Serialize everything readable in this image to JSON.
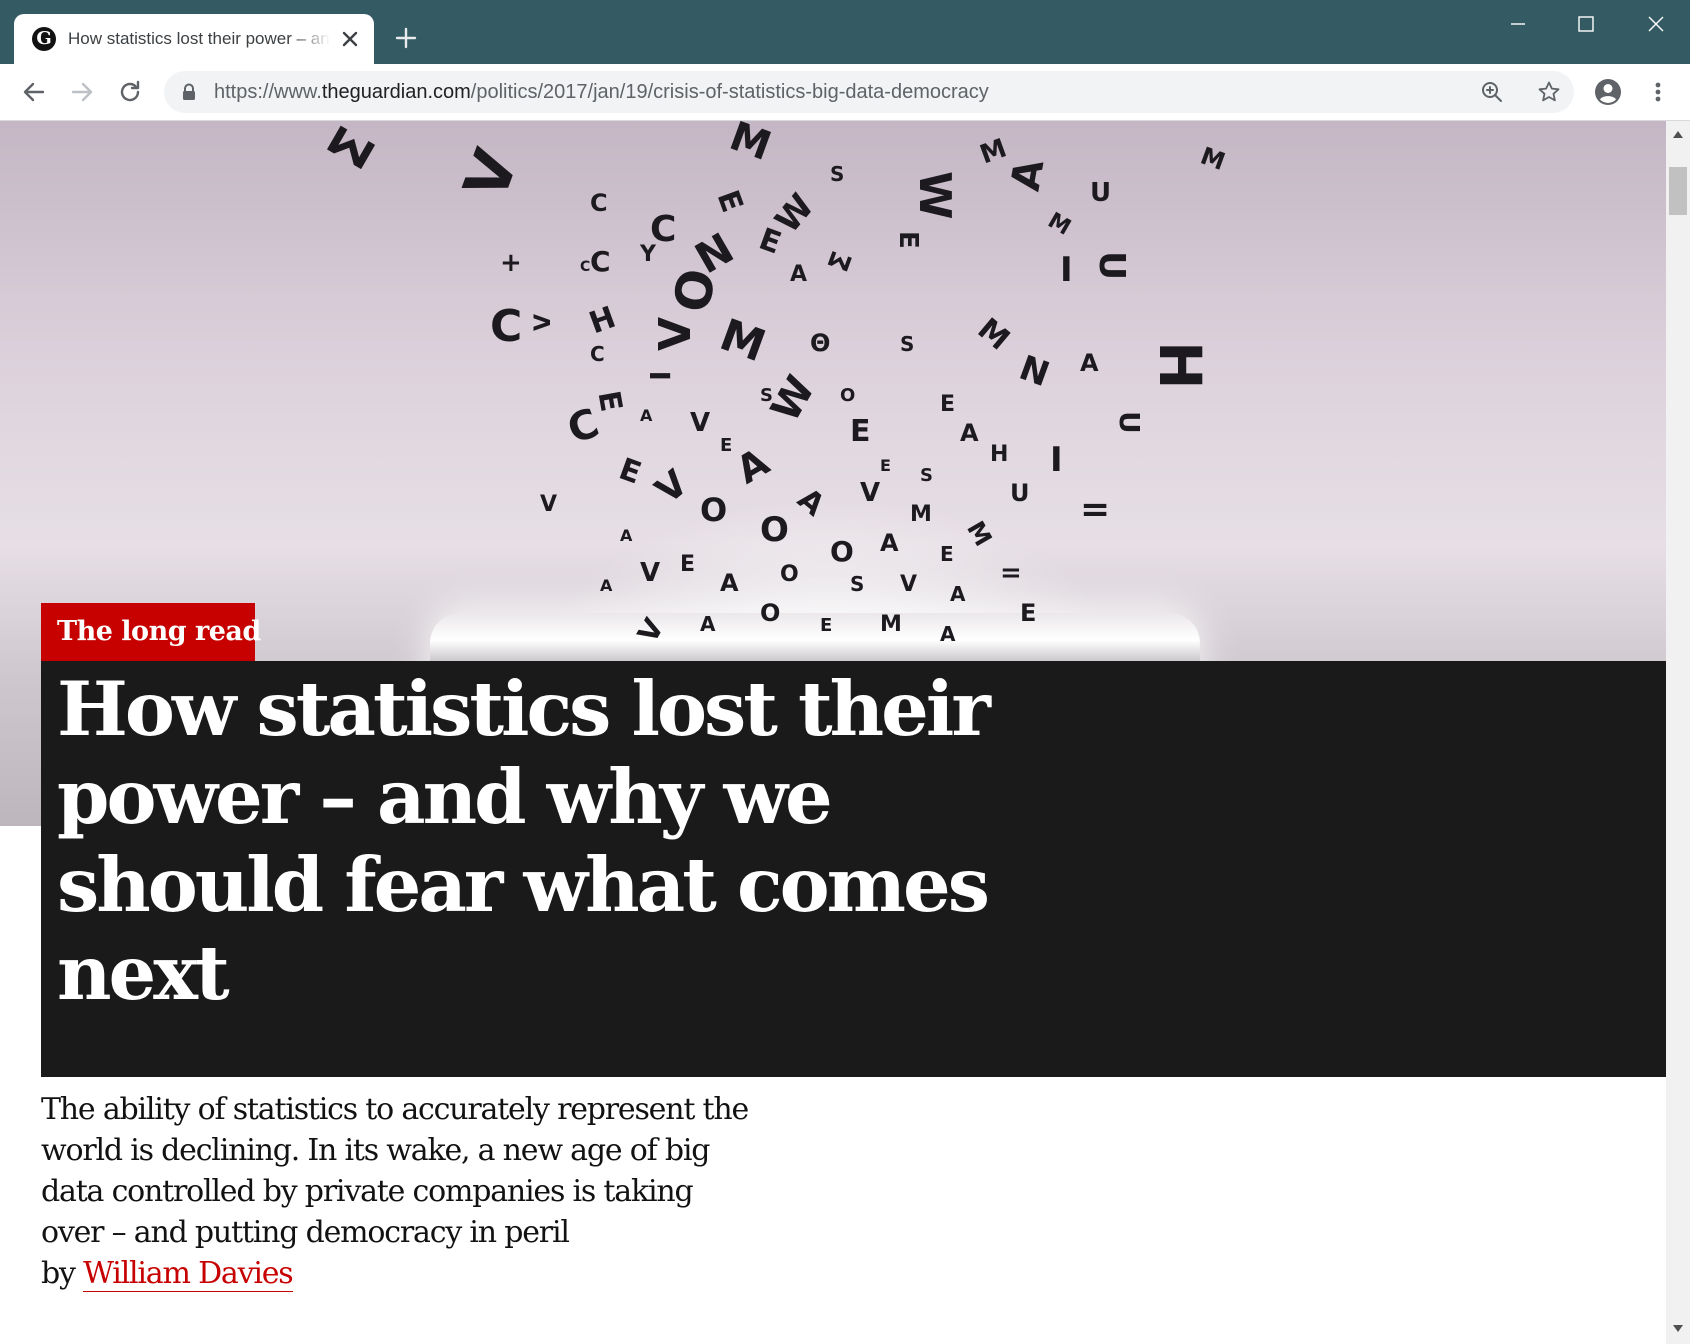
{
  "browser": {
    "tab_title": "How statistics lost their power – and why we should fear what comes next",
    "favicon_letter": "G",
    "url_scheme": "https://www.",
    "url_host": "theguardian.com",
    "url_path": "/politics/2017/jan/19/crisis-of-statistics-big-data-democracy",
    "chrome_color": "#345b63"
  },
  "icons": {
    "tab_close": "close-icon",
    "new_tab": "plus-icon",
    "back": "arrow-left-icon",
    "forward": "arrow-right-icon",
    "reload": "reload-icon",
    "lock": "lock-icon",
    "zoom": "zoom-icon",
    "bookmark": "star-icon",
    "account": "account-icon",
    "menu": "kebab-menu-icon"
  },
  "article": {
    "kicker": "The long read",
    "headline": "How statistics lost their power – and why we should fear what comes next",
    "standfirst": "The ability of statistics to accurately represent the world is declining. In its wake, a new age of big data controlled by private companies is taking over – and putting democracy in peril",
    "byline_prefix": "by",
    "author": "William Davies",
    "accent_color": "#c70000",
    "headline_bg": "#1a1a1a"
  }
}
